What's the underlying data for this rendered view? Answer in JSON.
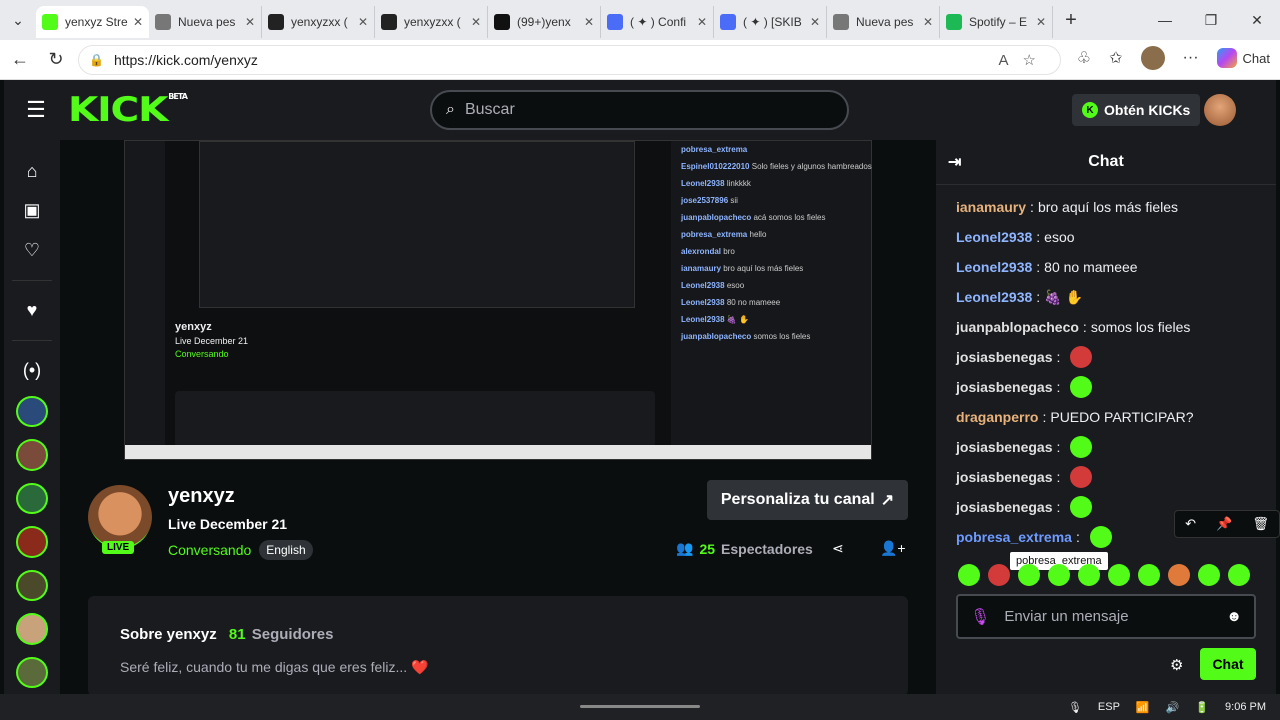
{
  "browser": {
    "tabs": [
      {
        "title": "yenxyz Stre",
        "color": "#53fc18",
        "icon": "kick-favicon",
        "active": true
      },
      {
        "title": "Nueva pes",
        "color": "#777777",
        "icon": "page-favicon",
        "active": false
      },
      {
        "title": "yenxyzxx (",
        "color": "#222222",
        "icon": "tiktok-favicon",
        "active": false
      },
      {
        "title": "yenxyzxx (",
        "color": "#222222",
        "icon": "tiktok-favicon",
        "active": false
      },
      {
        "title": "(99+)yenx",
        "color": "#111111",
        "icon": "tiktok-favicon",
        "active": false
      },
      {
        "title": "( ✦ ) Confi",
        "color": "#4a6cf7",
        "icon": "discord-favicon",
        "active": false
      },
      {
        "title": "( ✦ ) [SKIB",
        "color": "#4a6cf7",
        "icon": "discord-favicon",
        "active": false
      },
      {
        "title": "Nueva pes",
        "color": "#777777",
        "icon": "page-favicon",
        "active": false
      },
      {
        "title": "Spotify – E",
        "color": "#1db954",
        "icon": "spotify-favicon",
        "active": false
      }
    ],
    "url": "https://kick.com/yenxyz",
    "copilot_label": "Chat"
  },
  "header": {
    "logo": "KICK",
    "logo_badge": "BETA",
    "search_placeholder": "Buscar",
    "kicks_button": "Obtén KICKs"
  },
  "stream": {
    "name": "yenxyz",
    "title": "Live December 21",
    "live_badge": "LIVE",
    "category": "Conversando",
    "tag": "English",
    "customize_button": "Personaliza tu canal",
    "viewers_count": "25",
    "viewers_label": "Espectadores"
  },
  "about": {
    "heading": "Sobre yenxyz",
    "followers_count": "81",
    "followers_label": "Seguidores",
    "bio": "Seré feliz, cuando tu me digas que eres feliz... ❤️"
  },
  "chat": {
    "title": "Chat",
    "messages": [
      {
        "user": "ianamaury",
        "text": "bro aquí los más fieles",
        "color": "#e7b27b",
        "emotes": []
      },
      {
        "user": "Leonel2938",
        "text": "esoo",
        "color": "#8fb5ff",
        "emotes": []
      },
      {
        "user": "Leonel2938",
        "text": "80 no mameee",
        "color": "#8fb5ff",
        "emotes": []
      },
      {
        "user": "Leonel2938",
        "text": "🍇 ✋",
        "color": "#8fb5ff",
        "emotes": []
      },
      {
        "user": "juanpablopacheco",
        "text": "somos los fieles",
        "color": "#e0e0e0",
        "emotes": []
      },
      {
        "user": "josiasbenegas",
        "text": "",
        "color": "#e0e0e0",
        "emotes": [
          "#d33a3a"
        ]
      },
      {
        "user": "josiasbenegas",
        "text": "",
        "color": "#e0e0e0",
        "emotes": [
          "#53fc18"
        ]
      },
      {
        "user": "draganperro",
        "text": "PUEDO PARTICIPAR?",
        "color": "#e7b27b",
        "emotes": []
      },
      {
        "user": "josiasbenegas",
        "text": "",
        "color": "#e0e0e0",
        "emotes": [
          "#53fc18"
        ]
      },
      {
        "user": "josiasbenegas",
        "text": "",
        "color": "#e0e0e0",
        "emotes": [
          "#d33a3a"
        ]
      },
      {
        "user": "josiasbenegas",
        "text": "",
        "color": "#e0e0e0",
        "emotes": [
          "#53fc18"
        ]
      },
      {
        "user": "pobresa_extrema",
        "text": "",
        "color": "#6f9bff",
        "emotes": [
          "#53fc18"
        ]
      }
    ],
    "tooltip": "pobresa_extrema",
    "input_placeholder": "Enviar un mensaje",
    "send_button": "Chat",
    "emote_bar": [
      "#53fc18",
      "#d33a3a",
      "#53fc18",
      "#53fc18",
      "#53fc18",
      "#53fc18",
      "#53fc18",
      "#e07a3a",
      "#53fc18",
      "#53fc18"
    ]
  },
  "taskbar": {
    "language": "ESP",
    "time": "9:06 PM"
  },
  "nested_chat": [
    {
      "user": "pobresa_extrema",
      "text": ""
    },
    {
      "user": "Espinel010222010",
      "text": "Solo fieles y algunos hambreados"
    },
    {
      "user": "Leonel2938",
      "text": "linkkkk"
    },
    {
      "user": "jose2537896",
      "text": "sii"
    },
    {
      "user": "juanpablopacheco",
      "text": "acá somos los fieles"
    },
    {
      "user": "pobresa_extrema",
      "text": "hello"
    },
    {
      "user": "alexrondal",
      "text": "bro"
    },
    {
      "user": "ianamaury",
      "text": "bro aquí los más fieles"
    },
    {
      "user": "Leonel2938",
      "text": "esoo"
    },
    {
      "user": "Leonel2938",
      "text": "80 no mameee"
    },
    {
      "user": "Leonel2938",
      "text": "🍇 ✋"
    },
    {
      "user": "juanpablopacheco",
      "text": "somos los fieles"
    }
  ]
}
